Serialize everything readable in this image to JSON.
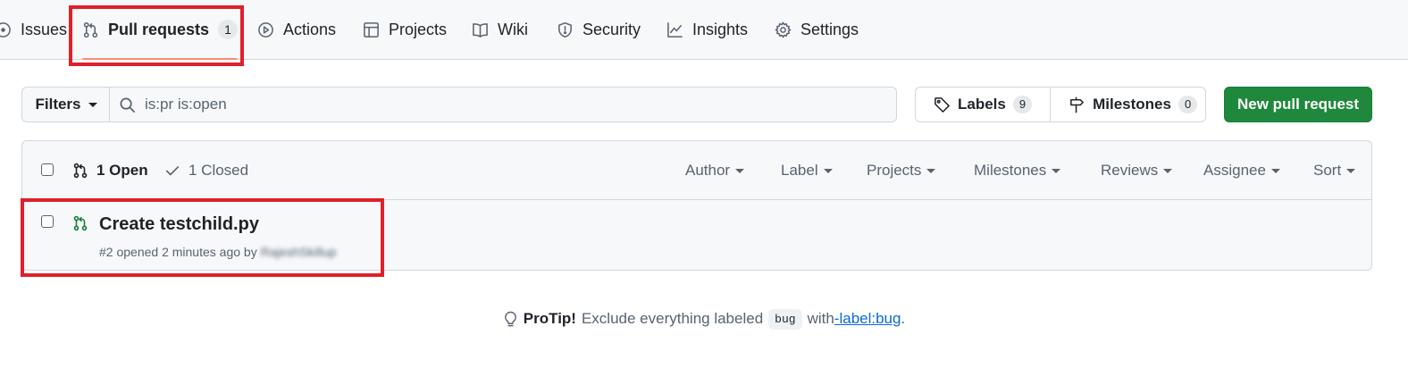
{
  "nav": {
    "items": [
      {
        "label": "Issues",
        "icon": "issue-opened-icon"
      },
      {
        "label": "Pull requests",
        "icon": "git-pull-request-icon",
        "count": "1",
        "selected": true
      },
      {
        "label": "Actions",
        "icon": "play-icon"
      },
      {
        "label": "Projects",
        "icon": "table-icon"
      },
      {
        "label": "Wiki",
        "icon": "book-icon"
      },
      {
        "label": "Security",
        "icon": "shield-icon"
      },
      {
        "label": "Insights",
        "icon": "graph-icon"
      },
      {
        "label": "Settings",
        "icon": "gear-icon"
      }
    ]
  },
  "filterbar": {
    "filters_label": "Filters",
    "search_value": "is:pr is:open",
    "labels_label": "Labels",
    "labels_count": "9",
    "milestones_label": "Milestones",
    "milestones_count": "0",
    "new_pr_label": "New pull request"
  },
  "list": {
    "open_label": "1 Open",
    "closed_label": "1 Closed",
    "filters": [
      "Author",
      "Label",
      "Projects",
      "Milestones",
      "Reviews",
      "Assignee",
      "Sort"
    ],
    "items": [
      {
        "title": "Create testchild.py",
        "meta": "#2 opened 2 minutes ago by",
        "author": "RajeshSkillup"
      }
    ]
  },
  "protip": {
    "prefix": "ProTip!",
    "text": "Exclude everything labeled",
    "code": "bug",
    "with": "with",
    "link": "-label:bug",
    "suffix": "."
  },
  "colors": {
    "primary_button": "#1f883d",
    "highlight": "#e0202a",
    "selected_underline": "#fd8c73",
    "link": "#0969da",
    "open_icon": "#1a7f37"
  }
}
